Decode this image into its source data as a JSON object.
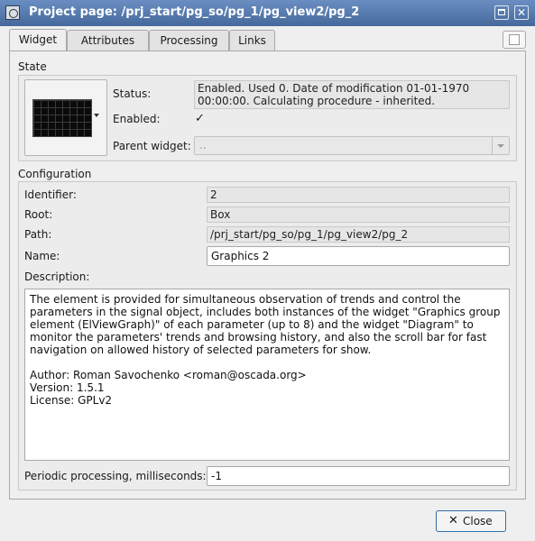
{
  "window": {
    "title": "Project page: /prj_start/pg_so/pg_1/pg_view2/pg_2"
  },
  "tabs": [
    {
      "label": "Widget",
      "active": true
    },
    {
      "label": "Attributes",
      "active": false
    },
    {
      "label": "Processing",
      "active": false
    },
    {
      "label": "Links",
      "active": false
    }
  ],
  "state": {
    "group_label": "State",
    "status_label": "Status:",
    "status_value": "Enabled. Used 0. Date of modification 01-01-1970 00:00:00. Calculating procedure - inherited.",
    "enabled_label": "Enabled:",
    "enabled_checked": true,
    "parent_label": "Parent widget:",
    "parent_value": ".."
  },
  "config": {
    "group_label": "Configuration",
    "identifier_label": "Identifier:",
    "identifier_value": "2",
    "root_label": "Root:",
    "root_value": "Box",
    "path_label": "Path:",
    "path_value": "/prj_start/pg_so/pg_1/pg_view2/pg_2",
    "name_label": "Name:",
    "name_value": "Graphics 2",
    "description_label": "Description:",
    "description_value": "The element is provided for simultaneous observation of trends and control the parameters in the signal object, includes both instances of the widget \"Graphics group element (ElViewGraph)\" of each parameter (up to 8) and the widget \"Diagram\" to monitor the parameters' trends and browsing history, and also the scroll bar for fast navigation on allowed history of selected parameters for show.\n\nAuthor: Roman Savochenko <roman@oscada.org>\nVersion: 1.5.1\nLicense: GPLv2",
    "periodic_label": "Periodic processing, milliseconds:",
    "periodic_value": "-1"
  },
  "buttons": {
    "close_label": "Close"
  },
  "colors": {
    "titlebar": "#4f73a6",
    "focus_border": "#2f6ea8"
  }
}
